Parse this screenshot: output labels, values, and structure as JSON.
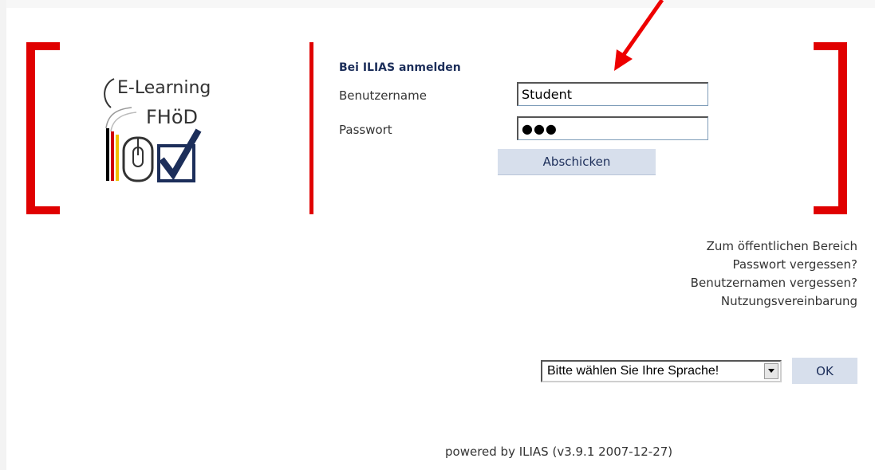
{
  "logo": {
    "line1": "E-Learning",
    "line2": "FHöD"
  },
  "login": {
    "title": "Bei ILIAS anmelden",
    "username_label": "Benutzername",
    "username_value": "Student",
    "password_label": "Passwort",
    "password_value": "●●●",
    "submit_label": "Abschicken"
  },
  "links": {
    "public_area": "Zum öffentlichen Bereich",
    "forgot_password": "Passwort vergessen?",
    "forgot_username": "Benutzernamen vergessen?",
    "terms": "Nutzungsvereinbarung"
  },
  "language": {
    "selected": "Bitte wählen Sie Ihre Sprache!",
    "ok_label": "OK"
  },
  "footer": {
    "powered_by": "powered by ILIAS (v3.9.1 2007-12-27)"
  },
  "colors": {
    "bracket_red": "#e00000",
    "title_navy": "#1c2e5a",
    "button_bg": "#d7dfec"
  },
  "icons": {
    "logo_mouse": "mouse-icon",
    "logo_checkbox": "checkbox-check-icon",
    "dropdown": "chevron-down-icon",
    "annotation": "red-arrow-icon"
  }
}
